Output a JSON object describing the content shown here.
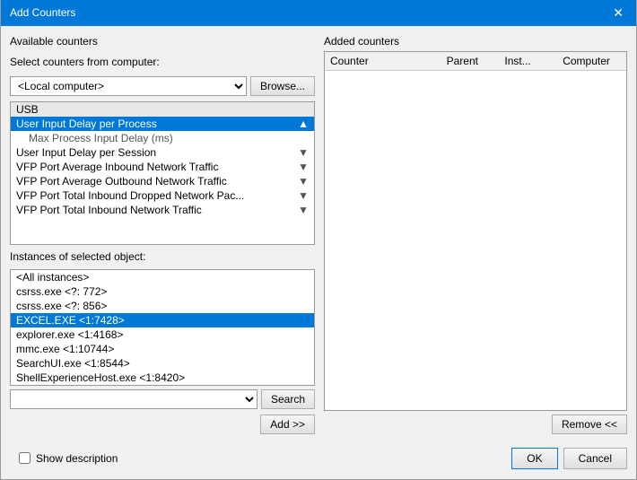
{
  "dialog": {
    "title": "Add Counters",
    "close_label": "✕"
  },
  "left": {
    "available_counters_label": "Available counters",
    "select_label": "Select counters from computer:",
    "computer_value": "<Local computer>",
    "browse_label": "Browse...",
    "counters": [
      {
        "text": "USB",
        "type": "category",
        "selected": false
      },
      {
        "text": "User Input Delay per Process",
        "type": "item",
        "selected": true,
        "expand": "▲"
      },
      {
        "text": "Max Process Input Delay (ms)",
        "type": "sub",
        "selected": false
      },
      {
        "text": "User Input Delay per Session",
        "type": "item",
        "selected": false,
        "expand": "▼"
      },
      {
        "text": "VFP Port Average Inbound Network Traffic",
        "type": "item",
        "selected": false,
        "expand": "▼"
      },
      {
        "text": "VFP Port Average Outbound Network Traffic",
        "type": "item",
        "selected": false,
        "expand": "▼"
      },
      {
        "text": "VFP Port Total Inbound Dropped Network Pac...",
        "type": "item",
        "selected": false,
        "expand": "▼"
      },
      {
        "text": "VFP Port Total Inbound Network Traffic",
        "type": "item",
        "selected": false,
        "expand": "▼"
      }
    ],
    "instances_label": "Instances of selected object:",
    "instances": [
      {
        "text": "<All instances>",
        "selected": false
      },
      {
        "text": "csrss.exe <?: 772>",
        "selected": false
      },
      {
        "text": "csrss.exe <?: 856>",
        "selected": false
      },
      {
        "text": "EXCEL.EXE <1:7428>",
        "selected": true
      },
      {
        "text": "explorer.exe <1:4168>",
        "selected": false
      },
      {
        "text": "mmc.exe <1:10744>",
        "selected": false
      },
      {
        "text": "SearchUI.exe <1:8544>",
        "selected": false
      },
      {
        "text": "ShellExperienceHost.exe <1:8420>",
        "selected": false
      }
    ],
    "search_placeholder": "",
    "search_label": "Search",
    "add_label": "Add >>"
  },
  "right": {
    "added_counters_label": "Added counters",
    "table_headers": [
      "Counter",
      "Parent",
      "Inst...",
      "Computer"
    ],
    "remove_label": "Remove <<"
  },
  "footer": {
    "show_desc_label": "Show description",
    "ok_label": "OK",
    "cancel_label": "Cancel"
  }
}
